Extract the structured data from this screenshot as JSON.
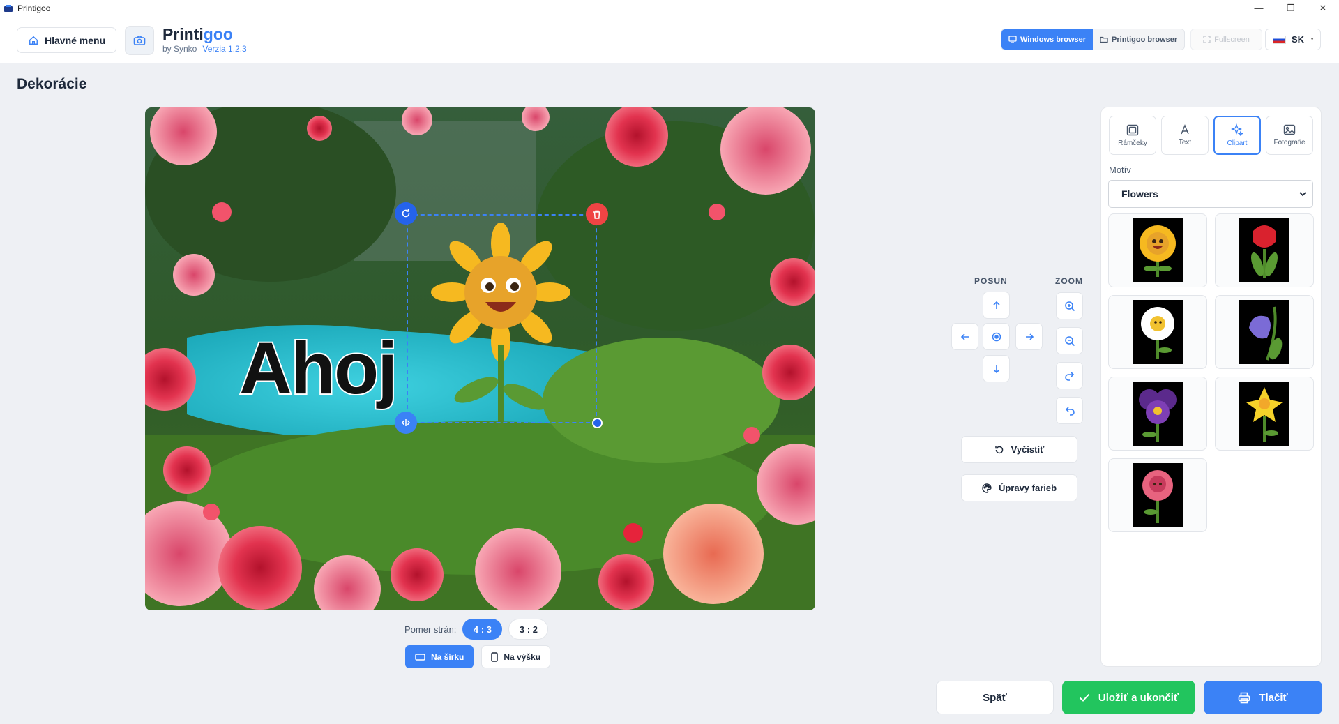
{
  "window": {
    "title": "Printigoo",
    "controls": [
      "—",
      "❐",
      "✕"
    ]
  },
  "header": {
    "home_label": "Hlavné menu",
    "brand_main": "Printi",
    "brand_accent": "goo",
    "by": "by Synko",
    "version": "Verzia 1.2.3",
    "browser_tabs": [
      "Windows browser",
      "Printigoo browser"
    ],
    "fullscreen": "Fullscreen",
    "language": "SK"
  },
  "page": {
    "title": "Dekorácie"
  },
  "canvas": {
    "text_element": "Ahoj"
  },
  "aspect": {
    "label": "Pomer strán:",
    "options": [
      "4 : 3",
      "3 : 2"
    ],
    "selected": "4 : 3"
  },
  "orientation": {
    "options": [
      "Na šírku",
      "Na výšku"
    ],
    "selected": "Na šírku"
  },
  "controls": {
    "move_label": "POSUN",
    "zoom_label": "ZOOM",
    "clear_label": "Vyčistiť",
    "colors_label": "Úpravy farieb"
  },
  "panel": {
    "tabs": [
      "Rámčeky",
      "Text",
      "Clipart",
      "Fotografie"
    ],
    "active_tab": "Clipart",
    "motiv_label": "Motív",
    "motiv_value": "Flowers",
    "cliparts": [
      "sunflower-clipart",
      "tulip-clipart",
      "daisy-clipart",
      "bluebell-clipart",
      "pansy-clipart",
      "daffodil-clipart",
      "rose-clipart"
    ]
  },
  "actions": {
    "back": "Späť",
    "save": "Uložiť a ukončiť",
    "print": "Tlačiť"
  },
  "colors": {
    "primary": "#3b82f6",
    "success": "#22c55e",
    "danger": "#ef4444"
  }
}
